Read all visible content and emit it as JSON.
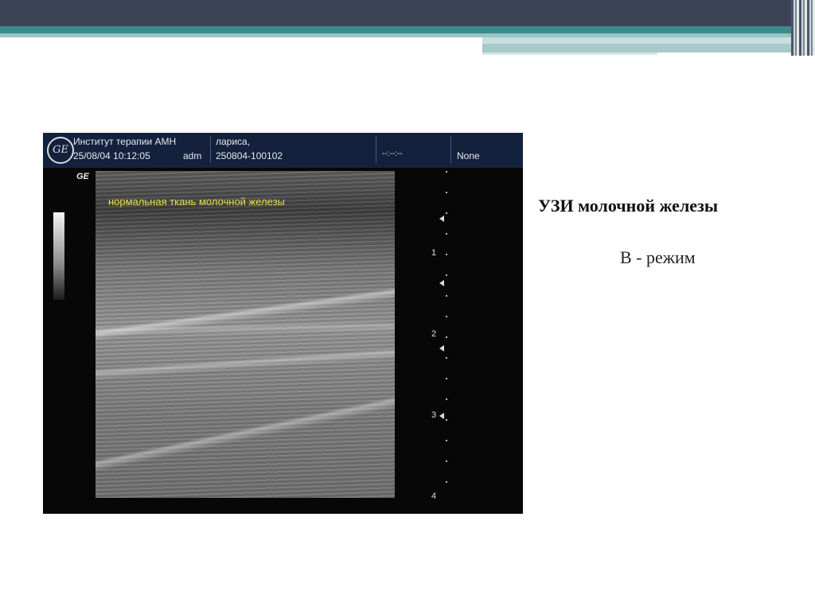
{
  "slide": {
    "title": "УЗИ молочной железы",
    "subtitle": "B - режим"
  },
  "ultrasound": {
    "logo": "GE",
    "header": {
      "institute": "Институт терапии АМН",
      "date_time": "25/08/04 10:12:05",
      "operator": "adm",
      "patient": "лариса,",
      "exam_id": "250804-100102",
      "clock": "--:--:--",
      "preset": "None"
    },
    "brand_mark": "GE",
    "annotation": "нормальная ткань молочной железы",
    "depth_marks": [
      "1",
      "2",
      "3",
      "4"
    ]
  },
  "colors": {
    "header_bar": "#3c4357",
    "teal_band": "#3e8a8d",
    "annotation_text": "#e6dc4e",
    "ultrasound_header": "#13213d"
  }
}
